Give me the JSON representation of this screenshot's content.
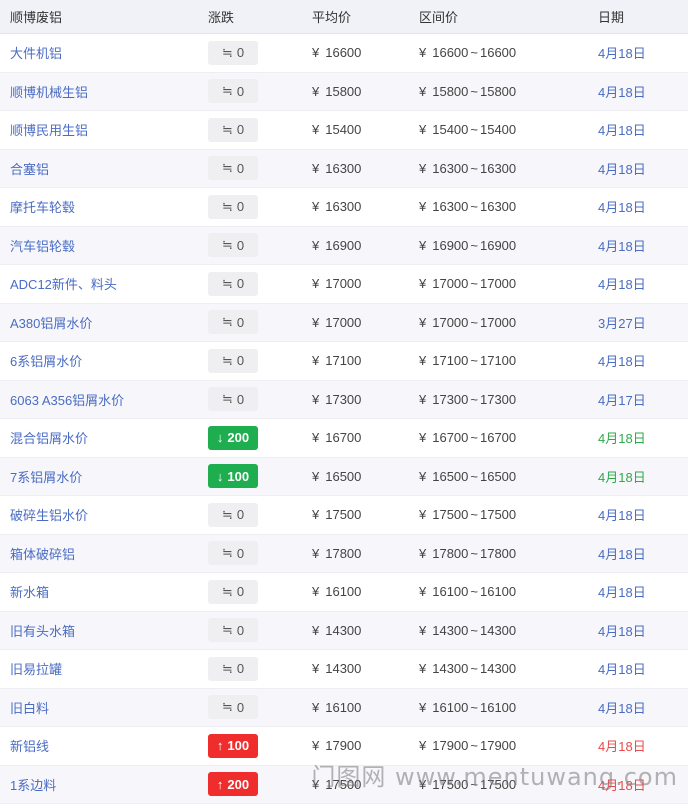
{
  "header": {
    "name": "顺博废铝",
    "change": "涨跌",
    "avg": "平均价",
    "range": "区间价",
    "date": "日期"
  },
  "currency": "¥",
  "range_sep": "~",
  "flat_symbol": "≒",
  "up_symbol": "↑",
  "down_symbol": "↓",
  "rows": [
    {
      "name": "大件机铝",
      "change": "0",
      "dir": "flat",
      "avg": "16600",
      "low": "16600",
      "high": "16600",
      "date": "4月18日"
    },
    {
      "name": "顺博机械生铝",
      "change": "0",
      "dir": "flat",
      "avg": "15800",
      "low": "15800",
      "high": "15800",
      "date": "4月18日"
    },
    {
      "name": "顺博民用生铝",
      "change": "0",
      "dir": "flat",
      "avg": "15400",
      "low": "15400",
      "high": "15400",
      "date": "4月18日"
    },
    {
      "name": "合塞铝",
      "change": "0",
      "dir": "flat",
      "avg": "16300",
      "low": "16300",
      "high": "16300",
      "date": "4月18日"
    },
    {
      "name": "摩托车轮毂",
      "change": "0",
      "dir": "flat",
      "avg": "16300",
      "low": "16300",
      "high": "16300",
      "date": "4月18日"
    },
    {
      "name": "汽车铝轮毂",
      "change": "0",
      "dir": "flat",
      "avg": "16900",
      "low": "16900",
      "high": "16900",
      "date": "4月18日"
    },
    {
      "name": "ADC12新件、料头",
      "change": "0",
      "dir": "flat",
      "avg": "17000",
      "low": "17000",
      "high": "17000",
      "date": "4月18日"
    },
    {
      "name": "A380铝屑水价",
      "change": "0",
      "dir": "flat",
      "avg": "17000",
      "low": "17000",
      "high": "17000",
      "date": "3月27日"
    },
    {
      "name": "6系铝屑水价",
      "change": "0",
      "dir": "flat",
      "avg": "17100",
      "low": "17100",
      "high": "17100",
      "date": "4月18日"
    },
    {
      "name": "6063 A356铝屑水价",
      "change": "0",
      "dir": "flat",
      "avg": "17300",
      "low": "17300",
      "high": "17300",
      "date": "4月17日"
    },
    {
      "name": "混合铝屑水价",
      "change": "200",
      "dir": "down",
      "avg": "16700",
      "low": "16700",
      "high": "16700",
      "date": "4月18日"
    },
    {
      "name": "7系铝屑水价",
      "change": "100",
      "dir": "down",
      "avg": "16500",
      "low": "16500",
      "high": "16500",
      "date": "4月18日"
    },
    {
      "name": "破碎生铝水价",
      "change": "0",
      "dir": "flat",
      "avg": "17500",
      "low": "17500",
      "high": "17500",
      "date": "4月18日"
    },
    {
      "name": "箱体破碎铝",
      "change": "0",
      "dir": "flat",
      "avg": "17800",
      "low": "17800",
      "high": "17800",
      "date": "4月18日"
    },
    {
      "name": "新水箱",
      "change": "0",
      "dir": "flat",
      "avg": "16100",
      "low": "16100",
      "high": "16100",
      "date": "4月18日"
    },
    {
      "name": "旧有头水箱",
      "change": "0",
      "dir": "flat",
      "avg": "14300",
      "low": "14300",
      "high": "14300",
      "date": "4月18日"
    },
    {
      "name": "旧易拉罐",
      "change": "0",
      "dir": "flat",
      "avg": "14300",
      "low": "14300",
      "high": "14300",
      "date": "4月18日"
    },
    {
      "name": "旧白料",
      "change": "0",
      "dir": "flat",
      "avg": "16100",
      "low": "16100",
      "high": "16100",
      "date": "4月18日"
    },
    {
      "name": "新铝线",
      "change": "100",
      "dir": "up",
      "avg": "17900",
      "low": "17900",
      "high": "17900",
      "date": "4月18日"
    },
    {
      "name": "1系边料",
      "change": "200",
      "dir": "up",
      "avg": "17500",
      "low": "17500",
      "high": "17500",
      "date": "4月18日"
    }
  ],
  "watermark": "门图网 www.mentuwang.com",
  "colors": {
    "link_blue": "#4a6cc3",
    "up_red": "#f02d2d",
    "down_green": "#1fae4f",
    "header_bg": "#f1f1f8"
  }
}
